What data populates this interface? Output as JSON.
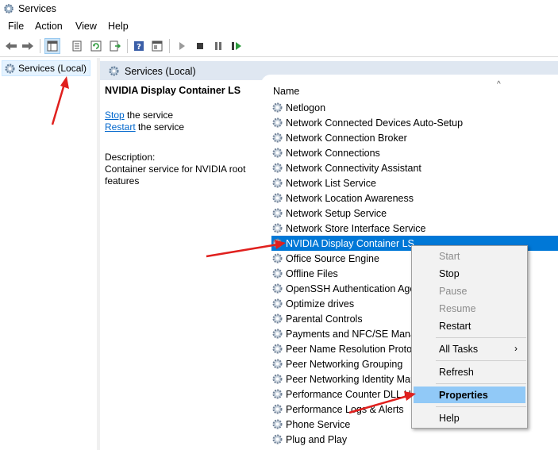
{
  "window": {
    "title": "Services"
  },
  "menu": [
    "File",
    "Action",
    "View",
    "Help"
  ],
  "toolbar": {
    "icons": [
      "back-arrow-icon",
      "forward-arrow-icon",
      "console-tree-icon",
      "properties-icon",
      "refresh-icon",
      "export-list-icon",
      "help-icon",
      "show-hide-icon",
      "start-service-icon",
      "stop-service-icon",
      "pause-service-icon",
      "restart-service-icon"
    ]
  },
  "tree": {
    "root_label": "Services (Local)"
  },
  "main": {
    "header": "Services (Local)",
    "service_name": "NVIDIA Display Container LS",
    "stop_link": "Stop",
    "stop_suffix": " the service",
    "restart_link": "Restart",
    "restart_suffix": " the service",
    "description_label": "Description:",
    "description_line1": "Container service for NVIDIA root",
    "description_line2": "features"
  },
  "list": {
    "column_name": "Name",
    "sort_indicator": "^",
    "rows": [
      "Netlogon",
      "Network Connected Devices Auto-Setup",
      "Network Connection Broker",
      "Network Connections",
      "Network Connectivity Assistant",
      "Network List Service",
      "Network Location Awareness",
      "Network Setup Service",
      "Network Store Interface Service",
      "NVIDIA Display Container LS",
      "Office  Source Engine",
      "Offline Files",
      "OpenSSH Authentication Agent",
      "Optimize drives",
      "Parental Controls",
      "Payments and NFC/SE Manager",
      "Peer Name Resolution Protocol",
      "Peer Networking Grouping",
      "Peer Networking Identity Manager",
      "Performance Counter DLL Host",
      "Performance Logs & Alerts",
      "Phone Service",
      "Plug and Play"
    ],
    "selected_index": 9
  },
  "context_menu": {
    "start": "Start",
    "stop": "Stop",
    "pause": "Pause",
    "resume": "Resume",
    "restart": "Restart",
    "all_tasks": "All Tasks",
    "all_tasks_arrow": "›",
    "refresh": "Refresh",
    "properties": "Properties",
    "help": "Help"
  },
  "colors": {
    "selection": "#0078d7",
    "menu_highlight": "#91c9f7",
    "annotation_arrow": "#e0201e",
    "header_band": "#dfe7f1"
  }
}
